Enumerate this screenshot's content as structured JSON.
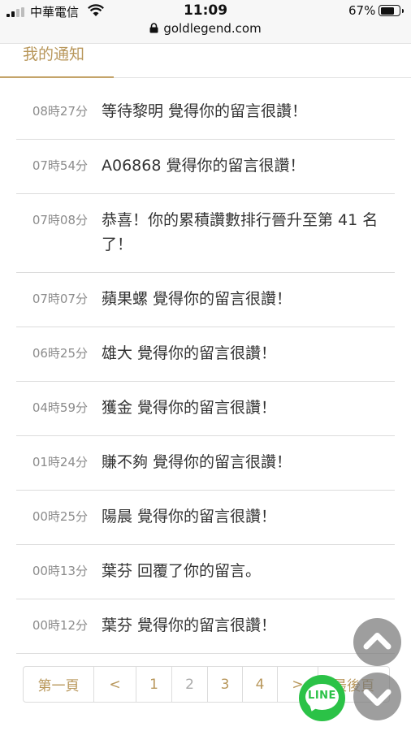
{
  "status_bar": {
    "carrier": "中華電信",
    "time": "11:09",
    "battery": "67%",
    "battery_level": 0.67,
    "url": "goldlegend.com"
  },
  "tab": {
    "label": "我的通知"
  },
  "notifications": [
    {
      "time": "08時27分",
      "message": "等待黎明 覺得你的留言很讚！"
    },
    {
      "time": "07時54分",
      "message": "A06868 覺得你的留言很讚！"
    },
    {
      "time": "07時08分",
      "message": "恭喜！你的累積讚數排行晉升至第 41 名了！"
    },
    {
      "time": "07時07分",
      "message": "蘋果螺 覺得你的留言很讚！"
    },
    {
      "time": "06時25分",
      "message": "雄大 覺得你的留言很讚！"
    },
    {
      "time": "04時59分",
      "message": "獲金 覺得你的留言很讚！"
    },
    {
      "time": "01時24分",
      "message": "賺不夠 覺得你的留言很讚！"
    },
    {
      "time": "00時25分",
      "message": "陽晨 覺得你的留言很讚！"
    },
    {
      "time": "00時13分",
      "message": "葉芬 回覆了你的留言。"
    },
    {
      "time": "00時12分",
      "message": "葉芬 覺得你的留言很讚！"
    }
  ],
  "pagination": {
    "first": "第一頁",
    "prev": "<",
    "pages": [
      "1",
      "2",
      "3",
      "4"
    ],
    "current": "2",
    "next": ">",
    "last": "最後頁"
  },
  "floating": {
    "line_label": "LINE"
  },
  "colors": {
    "accent": "#b8975b",
    "line_green": "#2bc247"
  }
}
